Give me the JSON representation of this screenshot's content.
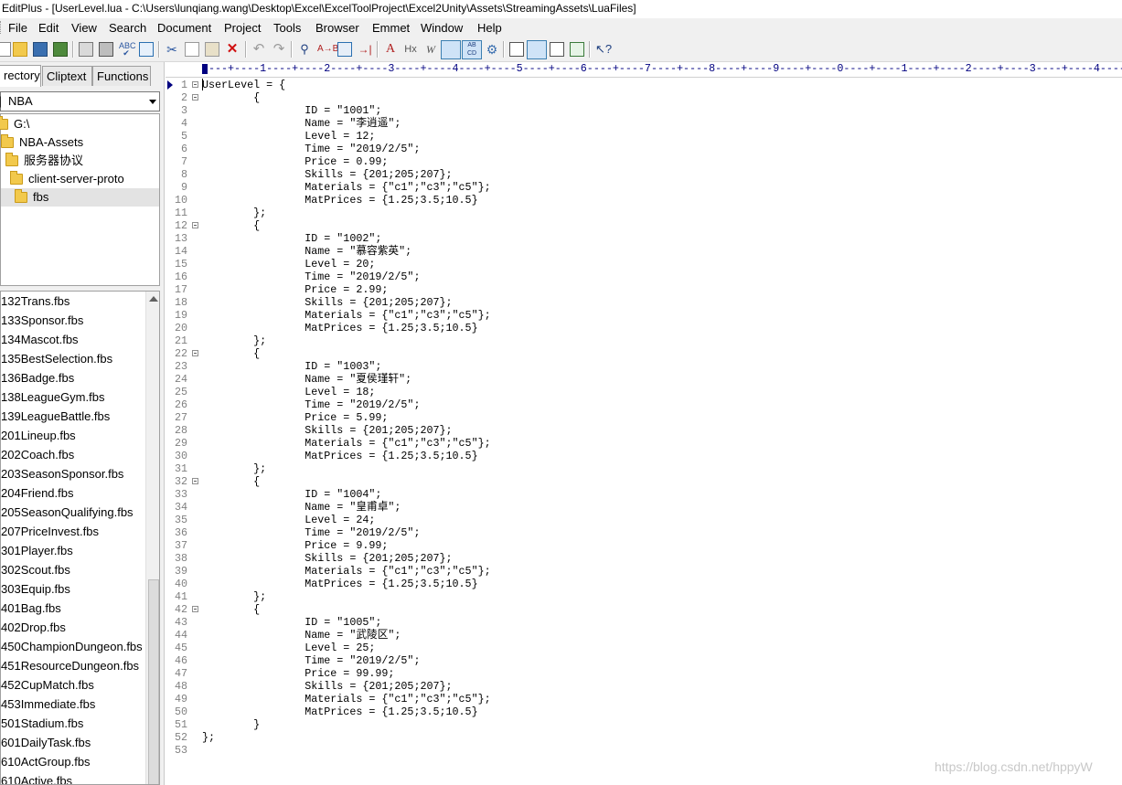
{
  "window": {
    "title": "EditPlus - [UserLevel.lua - C:\\Users\\lunqiang.wang\\Desktop\\Excel\\ExcelToolProject\\Excel2Unity\\Assets\\StreamingAssets\\LuaFiles]"
  },
  "menu": [
    "File",
    "Edit",
    "View",
    "Search",
    "Document",
    "Project",
    "Tools",
    "Browser",
    "Emmet",
    "Window",
    "Help"
  ],
  "toolbar": {
    "icons": [
      "new-file-icon",
      "open-folder-icon",
      "save-icon",
      "save-all-icon",
      "print-preview-icon",
      "print-icon",
      "spell-check-icon",
      "browser-preview-icon",
      "cut-icon",
      "copy-icon",
      "paste-icon",
      "delete-icon",
      "undo-icon",
      "redo-icon",
      "find-icon",
      "replace-icon",
      "find-in-files-icon",
      "goto-icon",
      "font-icon",
      "hex-icon",
      "word-wrap-icon",
      "line-number-icon",
      "abc-icon",
      "settings-icon",
      "directory-window-icon",
      "cliptext-window-icon",
      "output-window-icon",
      "fullscreen-icon",
      "help-icon"
    ]
  },
  "sidebar": {
    "tabs": [
      "rectory",
      "Cliptext",
      "Functions"
    ],
    "drive": "NBA",
    "tree": [
      {
        "label": "G:\\",
        "indent": 0
      },
      {
        "label": "NBA-Assets",
        "indent": 1
      },
      {
        "label": "服务器协议",
        "indent": 2
      },
      {
        "label": "client-server-proto",
        "indent": 3
      },
      {
        "label": "fbs",
        "indent": 4,
        "selected": true
      }
    ],
    "files": [
      "132Trans.fbs",
      "133Sponsor.fbs",
      "134Mascot.fbs",
      "135BestSelection.fbs",
      "136Badge.fbs",
      "138LeagueGym.fbs",
      "139LeagueBattle.fbs",
      "201Lineup.fbs",
      "202Coach.fbs",
      "203SeasonSponsor.fbs",
      "204Friend.fbs",
      "205SeasonQualifying.fbs",
      "207PriceInvest.fbs",
      "301Player.fbs",
      "302Scout.fbs",
      "303Equip.fbs",
      "401Bag.fbs",
      "402Drop.fbs",
      "450ChampionDungeon.fbs",
      "451ResourceDungeon.fbs",
      "452CupMatch.fbs",
      "453Immediate.fbs",
      "501Stadium.fbs",
      "601DailyTask.fbs",
      "610ActGroup.fbs",
      "610Active.fbs"
    ]
  },
  "editor": {
    "ruler": "---+----1----+----2----+----3----+----4----+----5----+----6----+----7----+----8----+----9----+----0----+----1----+----2----+----3----+----4----",
    "lines": [
      "UserLevel = {",
      "        {",
      "                ID = \"1001\";",
      "                Name = \"李逍遥\";",
      "                Level = 12;",
      "                Time = \"2019/2/5\";",
      "                Price = 0.99;",
      "                Skills = {201;205;207};",
      "                Materials = {\"c1\";\"c3\";\"c5\"};",
      "                MatPrices = {1.25;3.5;10.5}",
      "        };",
      "        {",
      "                ID = \"1002\";",
      "                Name = \"慕容紫英\";",
      "                Level = 20;",
      "                Time = \"2019/2/5\";",
      "                Price = 2.99;",
      "                Skills = {201;205;207};",
      "                Materials = {\"c1\";\"c3\";\"c5\"};",
      "                MatPrices = {1.25;3.5;10.5}",
      "        };",
      "        {",
      "                ID = \"1003\";",
      "                Name = \"夏侯瑾轩\";",
      "                Level = 18;",
      "                Time = \"2019/2/5\";",
      "                Price = 5.99;",
      "                Skills = {201;205;207};",
      "                Materials = {\"c1\";\"c3\";\"c5\"};",
      "                MatPrices = {1.25;3.5;10.5}",
      "        };",
      "        {",
      "                ID = \"1004\";",
      "                Name = \"皇甫卓\";",
      "                Level = 24;",
      "                Time = \"2019/2/5\";",
      "                Price = 9.99;",
      "                Skills = {201;205;207};",
      "                Materials = {\"c1\";\"c3\";\"c5\"};",
      "                MatPrices = {1.25;3.5;10.5}",
      "        };",
      "        {",
      "                ID = \"1005\";",
      "                Name = \"武陵区\";",
      "                Level = 25;",
      "                Time = \"2019/2/5\";",
      "                Price = 99.99;",
      "                Skills = {201;205;207};",
      "                Materials = {\"c1\";\"c3\";\"c5\"};",
      "                MatPrices = {1.25;3.5;10.5}",
      "        }",
      "};",
      ""
    ],
    "fold_lines": [
      1,
      2,
      12,
      22,
      32,
      42
    ]
  },
  "watermark": "https://blog.csdn.net/hppyW"
}
